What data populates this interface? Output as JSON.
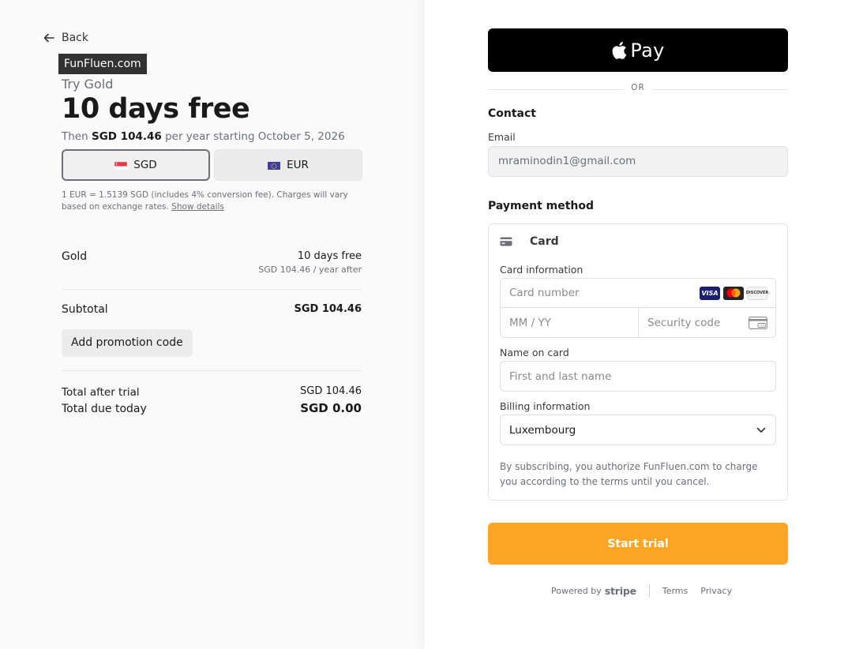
{
  "summary": {
    "back_label": "Back",
    "brand": "FunFluen.com",
    "try_label": "Try Gold",
    "headline": "10 days free",
    "then_prefix": "Then ",
    "then_amount": "SGD 104.46",
    "then_suffix": " per year starting October 5, 2026",
    "currencies": [
      {
        "code": "SGD",
        "selected": true
      },
      {
        "code": "EUR",
        "selected": false
      }
    ],
    "rate_text": "1 EUR = 1.5139 SGD (includes 4% conversion fee). Charges will vary based on exchange rates. ",
    "rate_link": "Show details",
    "line_item": {
      "name": "Gold",
      "price": "10 days free",
      "detail": "SGD 104.46 / year after"
    },
    "subtotal_label": "Subtotal",
    "subtotal_value": "SGD 104.46",
    "promo_label": "Add promotion code",
    "total_after_trial_label": "Total after trial",
    "total_after_trial_value": "SGD 104.46",
    "total_due_label": "Total due today",
    "total_due_value": "SGD 0.00"
  },
  "checkout": {
    "apple_pay_label": "Pay",
    "or_label": "OR",
    "contact_heading": "Contact",
    "email_label": "Email",
    "email_value": "mraminodin1@gmail.com",
    "payment_heading": "Payment method",
    "card_tab_label": "Card",
    "card_info_label": "Card information",
    "card_number_placeholder": "Card number",
    "expiry_placeholder": "MM / YY",
    "cvc_placeholder": "Security code",
    "card_brands": [
      "VISA",
      "mastercard",
      "DISCOVER"
    ],
    "name_label": "Name on card",
    "name_placeholder": "First and last name",
    "billing_label": "Billing information",
    "country_value": "Luxembourg",
    "legal_text": "By subscribing, you authorize FunFluen.com to charge you according to the terms until you cancel.",
    "start_button": "Start trial",
    "button_color": "#ffa526"
  },
  "footer": {
    "powered_by": "Powered by",
    "stripe": "stripe",
    "terms": "Terms",
    "privacy": "Privacy"
  }
}
